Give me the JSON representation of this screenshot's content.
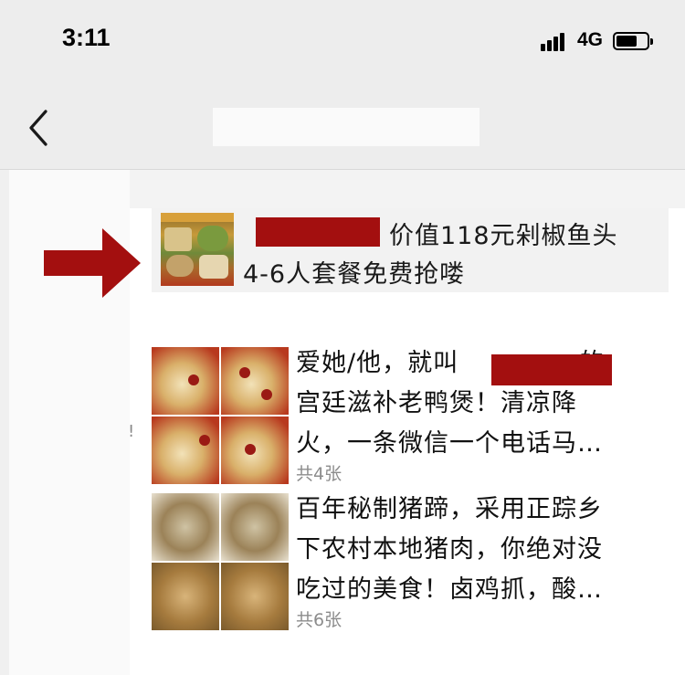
{
  "status_bar": {
    "time": "3:11",
    "network": "4G"
  },
  "nav": {
    "back_icon": "chevron-left-icon"
  },
  "shared_link": {
    "line1": "价值118元剁椒鱼头",
    "line2": "4-6人套餐免费抢喽"
  },
  "albums": [
    {
      "lines": [
        "爱她/他，就叫",
        "宫廷滋补老鸭煲！清凉降",
        "火，一条微信一个电话马…"
      ],
      "line1_suffix": "的",
      "count": "共4张"
    },
    {
      "lines": [
        "百年秘制猪蹄，采用正踪乡",
        "下农村本地猪肉，你绝对没",
        "吃过的美食！卤鸡抓，酸…"
      ],
      "count": "共6张"
    }
  ],
  "colors": {
    "redaction": "#a30f0f",
    "arrow": "#a30f0f"
  }
}
